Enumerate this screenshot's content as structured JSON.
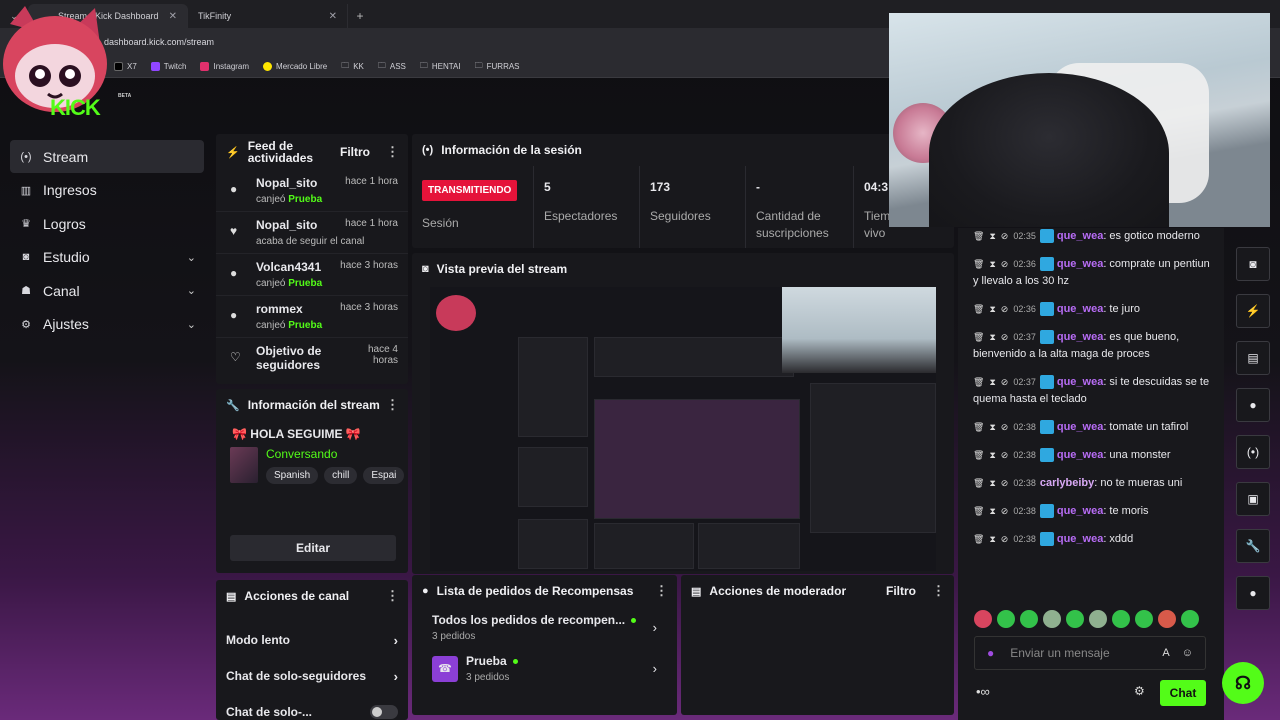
{
  "browser": {
    "tabs": [
      {
        "label": "Stream - Kick Dashboard",
        "active": true
      },
      {
        "label": "TikFinity",
        "active": false
      }
    ],
    "address": "dashboard.kick.com/stream",
    "bookmarks": [
      "X7",
      "Twitch",
      "Instagram",
      "Mercado Libre",
      "KK",
      "ASS",
      "HENTAI",
      "FURRAS"
    ]
  },
  "brand": {
    "badge": "BETA",
    "logo_text": "KICK"
  },
  "sidebar": {
    "items": [
      {
        "label": "Stream",
        "icon": "broadcast-icon"
      },
      {
        "label": "Ingresos",
        "icon": "chart-icon"
      },
      {
        "label": "Logros",
        "icon": "trophy-icon"
      },
      {
        "label": "Estudio",
        "icon": "camera-icon"
      },
      {
        "label": "Canal",
        "icon": "users-icon"
      },
      {
        "label": "Ajustes",
        "icon": "gear-icon"
      }
    ]
  },
  "feed": {
    "title": "Feed de actividades",
    "filter": "Filtro",
    "items": [
      {
        "user": "Nopal_sito",
        "time": "hace 1 hora",
        "action": "canjeó",
        "highlight": "Prueba"
      },
      {
        "user": "Nopal_sito",
        "time": "hace 1 hora",
        "action": "acaba de seguir el canal",
        "highlight": ""
      },
      {
        "user": "Volcan4341",
        "time": "hace 3 horas",
        "action": "canjeó",
        "highlight": "Prueba"
      },
      {
        "user": "rommex",
        "time": "hace 3 horas",
        "action": "canjeó",
        "highlight": "Prueba"
      },
      {
        "user": "Objetivo de seguidores",
        "time": "hace 4 horas",
        "action": "",
        "highlight": ""
      }
    ]
  },
  "stream_info": {
    "title": "Información del stream",
    "stream_title": "🎀 HOLA SEGUIME 🎀",
    "category": "Conversando",
    "tags": [
      "Spanish",
      "chill",
      "Espai"
    ],
    "edit": "Editar"
  },
  "channel_actions": {
    "title": "Acciones de canal",
    "items": [
      "Modo lento",
      "Chat de solo-seguidores",
      "Chat de solo-..."
    ]
  },
  "session": {
    "title": "Información de la sesión",
    "status": "TRANSMITIENDO",
    "status_label": "Sesión",
    "stats": [
      {
        "value": "5",
        "label": "Espectadores"
      },
      {
        "value": "173",
        "label": "Seguidores"
      },
      {
        "value": "-",
        "label": "Cantidad de suscripciones"
      },
      {
        "value": "04:3",
        "label": "Tiem vivo"
      }
    ]
  },
  "preview": {
    "title": "Vista previa del stream"
  },
  "rewards": {
    "title": "Lista de pedidos de Recompensas",
    "items": [
      {
        "title": "Todos los pedidos de recompen...",
        "sub": "3 pedidos"
      },
      {
        "title": "Prueba",
        "sub": "3 pedidos"
      }
    ]
  },
  "mod_actions": {
    "title": "Acciones de moderador",
    "filter": "Filtro"
  },
  "chat": {
    "messages": [
      {
        "time": "02:35",
        "user": "que_wea",
        "text": ": es gotico moderno"
      },
      {
        "time": "02:36",
        "user": "que_wea",
        "text": ": comprate un pentiun y llevalo a los 30 hz"
      },
      {
        "time": "02:36",
        "user": "que_wea",
        "text": ": te juro"
      },
      {
        "time": "02:37",
        "user": "que_wea",
        "text": ": es que bueno, bienvenido a la alta maga de proces"
      },
      {
        "time": "02:37",
        "user": "que_wea",
        "text": ": si te descuidas se te quema hasta el teclado"
      },
      {
        "time": "02:38",
        "user": "que_wea",
        "text": ": tomate un tafirol"
      },
      {
        "time": "02:38",
        "user": "que_wea",
        "text": ": una monster"
      },
      {
        "time": "02:38",
        "user": "carlybeiby",
        "text": ": no te mueras uni"
      },
      {
        "time": "02:38",
        "user": "que_wea",
        "text": ": te moris"
      },
      {
        "time": "02:38",
        "user": "que_wea",
        "text": ": xddd"
      }
    ],
    "placeholder": "Enviar un mensaje",
    "send": "Chat",
    "user_color": "#b76cf5"
  },
  "colors": {
    "accent": "#53fc18",
    "live": "#e5133a"
  }
}
